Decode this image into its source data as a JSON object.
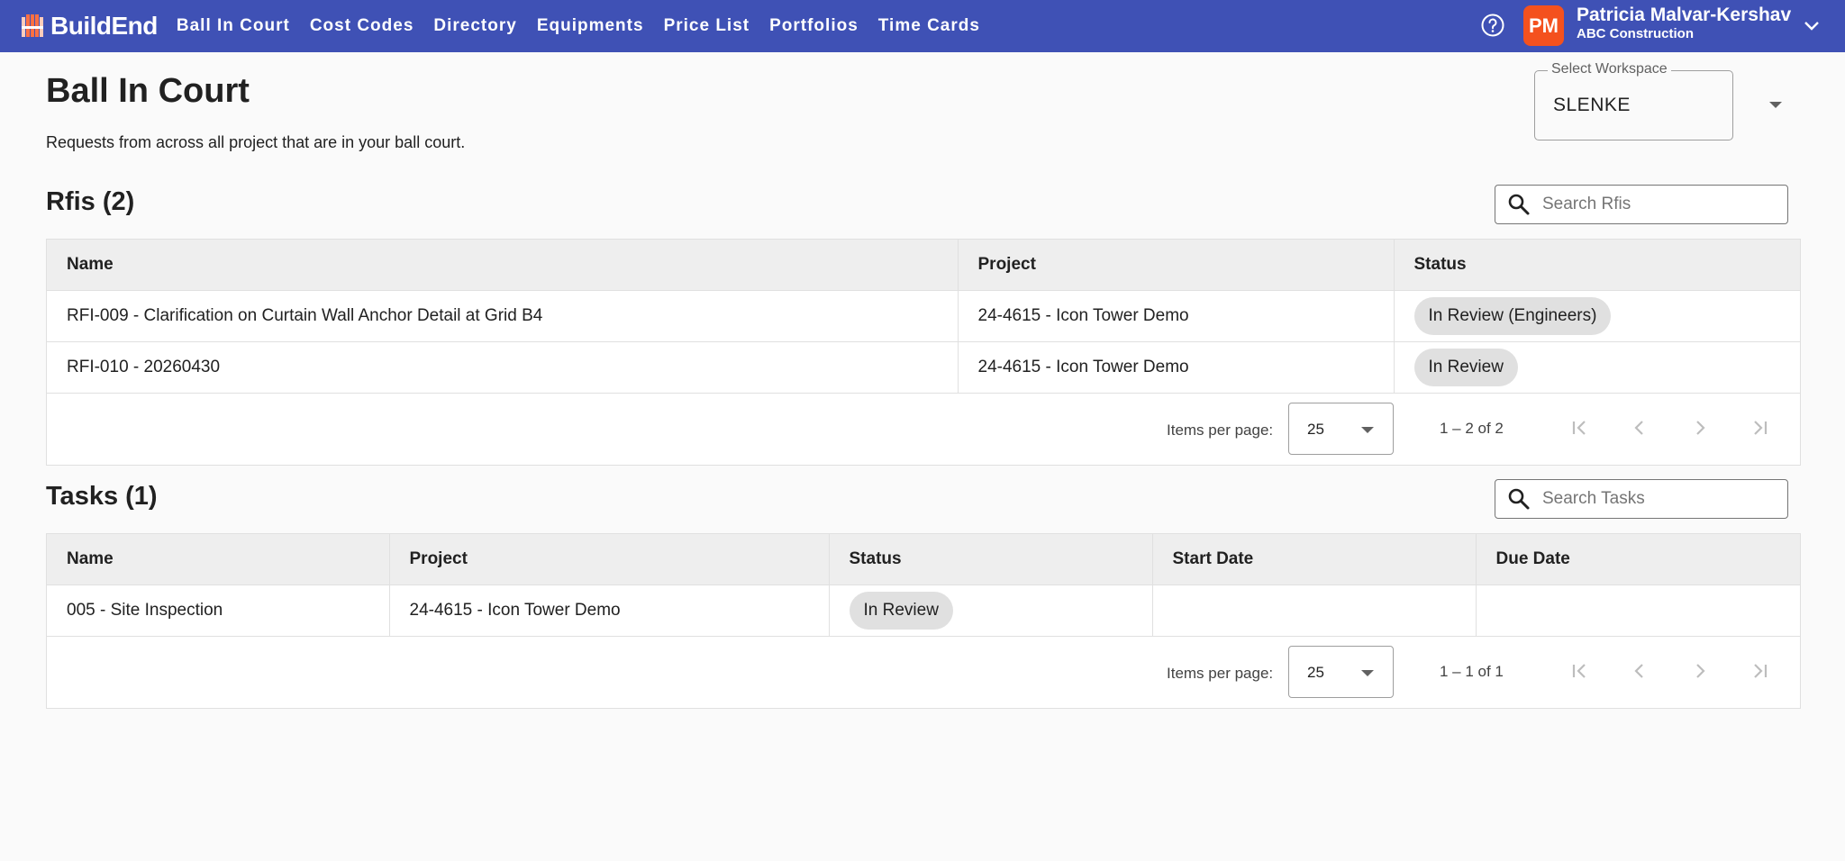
{
  "app": {
    "brand": "BuildEnd"
  },
  "nav": {
    "items": [
      {
        "label": "Ball In Court"
      },
      {
        "label": "Cost Codes"
      },
      {
        "label": "Directory"
      },
      {
        "label": "Equipments"
      },
      {
        "label": "Price List"
      },
      {
        "label": "Portfolios"
      },
      {
        "label": "Time Cards"
      }
    ]
  },
  "user": {
    "initials": "PM",
    "name": "Patricia Malvar-Kershav",
    "org": "ABC Construction",
    "avatar_color": "#f4511e"
  },
  "header": {
    "title": "Ball In Court",
    "subtitle": "Requests from across all project that are in your ball court."
  },
  "workspace": {
    "label": "Select Workspace",
    "value": "SLENKE"
  },
  "rfis": {
    "title": "Rfis (2)",
    "search_placeholder": "Search Rfis",
    "columns": [
      "Name",
      "Project",
      "Status"
    ],
    "rows": [
      {
        "name": "RFI-009 - Clarification on Curtain Wall Anchor Detail at Grid B4",
        "project": "24-4615 - Icon Tower Demo",
        "status": "In Review (Engineers)"
      },
      {
        "name": "RFI-010 - 20260430",
        "project": "24-4615 - Icon Tower Demo",
        "status": "In Review"
      }
    ],
    "paginator": {
      "items_per_page_label": "Items per page:",
      "page_size": "25",
      "range": "1 – 2 of 2"
    }
  },
  "tasks": {
    "title": "Tasks (1)",
    "search_placeholder": "Search Tasks",
    "columns": [
      "Name",
      "Project",
      "Status",
      "Start Date",
      "Due Date"
    ],
    "rows": [
      {
        "name": "005 - Site Inspection",
        "project": "24-4615 - Icon Tower Demo",
        "status": "In Review",
        "start_date": "",
        "due_date": ""
      }
    ],
    "paginator": {
      "items_per_page_label": "Items per page:",
      "page_size": "25",
      "range": "1 – 1 of 1"
    }
  },
  "theme": {
    "primary": "#3f51b5",
    "chip_bg": "#e0e0e0"
  },
  "icons": {
    "help": "help-circle-icon",
    "search": "search-icon",
    "chevron": "chevron-down-icon",
    "first": "first-page-icon",
    "prev": "chevron-left-icon",
    "next": "chevron-right-icon",
    "last": "last-page-icon"
  }
}
